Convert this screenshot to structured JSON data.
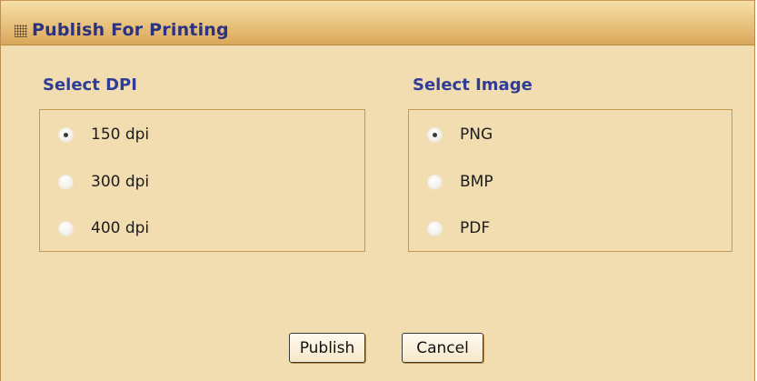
{
  "dialog": {
    "title": "Publish For Printing"
  },
  "dpi_section": {
    "title": "Select DPI",
    "options": [
      {
        "label": "150 dpi",
        "selected": true
      },
      {
        "label": "300 dpi",
        "selected": false
      },
      {
        "label": "400 dpi",
        "selected": false
      }
    ]
  },
  "image_section": {
    "title": "Select Image",
    "options": [
      {
        "label": "PNG",
        "selected": true
      },
      {
        "label": "BMP",
        "selected": false
      },
      {
        "label": "PDF",
        "selected": false
      }
    ]
  },
  "buttons": {
    "publish": "Publish",
    "cancel": "Cancel"
  },
  "colors": {
    "background": "#f2ddb1",
    "title_text": "#2b3282",
    "section_text": "#2f3d96",
    "group_border": "#c9974d"
  },
  "icons": {
    "titlebar_grip": "grip-icon"
  }
}
